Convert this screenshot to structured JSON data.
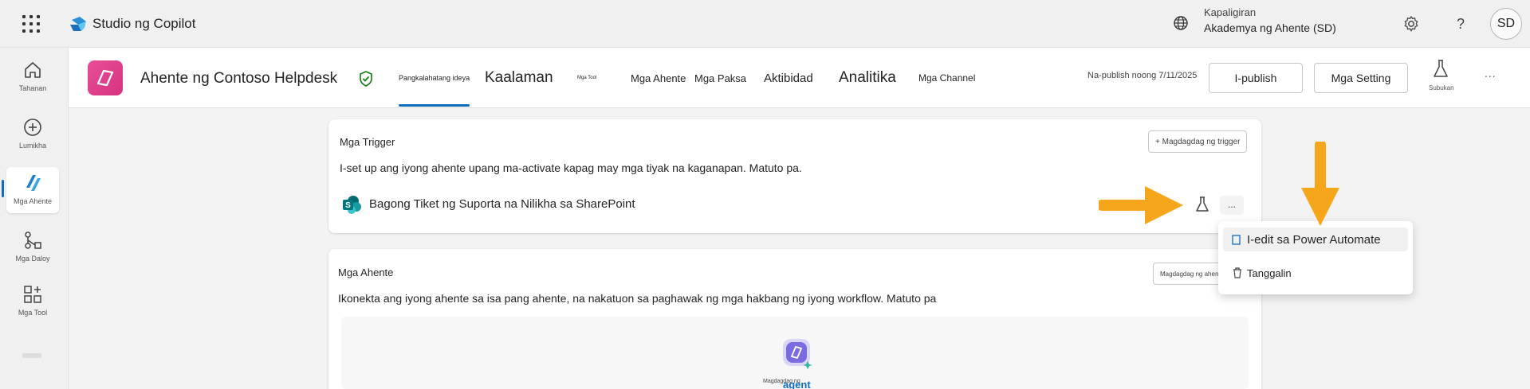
{
  "topbar": {
    "app_title": "Studio ng Copilot",
    "env_label": "Kapaligiran",
    "env_name": "Akademya ng Ahente (SD)",
    "help_glyph": "?",
    "avatar_initials": "SD"
  },
  "rail": {
    "items": [
      {
        "label": "Tahanan",
        "icon": "home-icon"
      },
      {
        "label": "Lumikha",
        "icon": "plus-circle-icon"
      },
      {
        "label": "Mga Ahente",
        "icon": "agents-icon"
      },
      {
        "label": "Mga Daloy",
        "icon": "flow-icon"
      },
      {
        "label": "Mga Tool",
        "icon": "apps-icon"
      }
    ]
  },
  "agent": {
    "name": "Ahente ng Contoso Helpdesk",
    "tabs": [
      {
        "label": "Pangkalahatang ideya",
        "active": true
      },
      {
        "label": "Kaalaman",
        "active": false
      },
      {
        "label": "Mga Tool",
        "active": false
      },
      {
        "label": "Mga Ahente",
        "active": false
      },
      {
        "label": "Mga Paksa",
        "active": false
      },
      {
        "label": "Aktibidad",
        "active": false
      },
      {
        "label": "Analitika",
        "active": false
      },
      {
        "label": "Mga Channel",
        "active": false
      }
    ],
    "publish_status": "Na-publish noong 7/11/2025",
    "publish_button": "I-publish",
    "settings_button": "Mga Setting",
    "test_label": "Subukan",
    "more_glyph": "..."
  },
  "triggers": {
    "title": "Mga Trigger",
    "add_button": "+ Magdagdag ng trigger",
    "description": "I-set up ang iyong ahente upang ma-activate kapag may mga tiyak na kaganapan. Matuto pa.",
    "items": [
      {
        "name": "Bagong Tiket ng Suporta na Nilikha sa SharePoint"
      }
    ],
    "row_more_glyph": "..."
  },
  "agents_section": {
    "title": "Mga Ahente",
    "add_button": "Magdagdag ng ahente",
    "description": "Ikonekta ang iyong ahente sa isa pang ahente, na nakatuon sa paghawak ng mga hakbang ng iyong workflow. Matuto pa",
    "placeholder_label": "Magdagdag ng",
    "placeholder_word": "agent"
  },
  "menu": {
    "items": [
      {
        "label": "I-edit sa Power Automate",
        "hover": true
      },
      {
        "label": "Tanggalin",
        "hover": false
      }
    ]
  },
  "colors": {
    "accent": "#0f6cbd",
    "arrow": "#f5a61b",
    "agent_logo": "#e0448c"
  }
}
